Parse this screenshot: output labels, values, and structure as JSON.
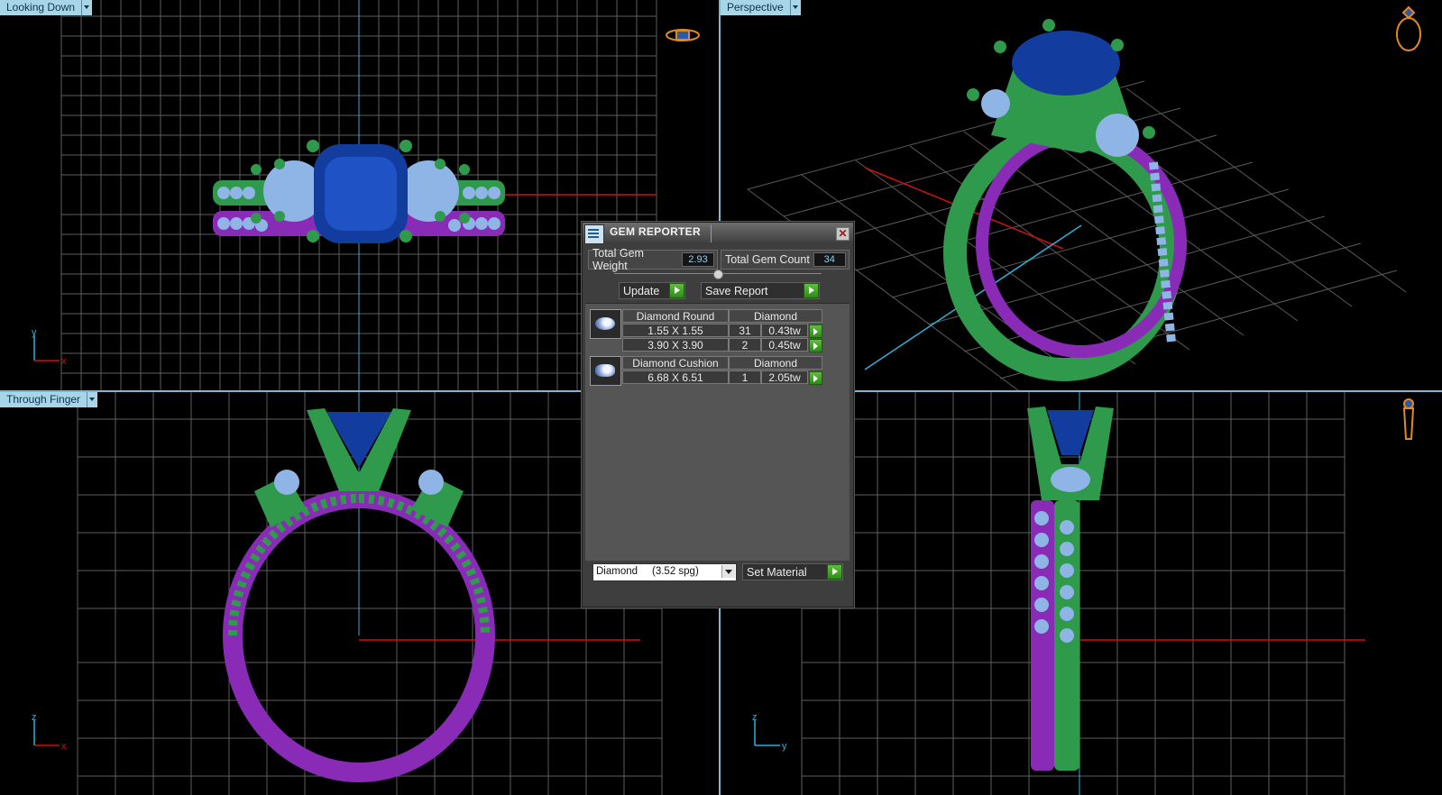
{
  "viewports": {
    "top_left": {
      "label": "Looking Down",
      "axis": {
        "vertical": "y",
        "horizontal": "x"
      }
    },
    "top_right": {
      "label": "Perspective"
    },
    "bottom_left": {
      "label": "Through Finger",
      "axis": {
        "vertical": "z",
        "horizontal": "x"
      }
    },
    "bottom_right": {
      "label": "",
      "axis": {
        "vertical": "z",
        "horizontal": "y"
      }
    }
  },
  "dialog": {
    "title": "GEM REPORTER",
    "close_glyph": "✕",
    "total_weight_label": "Total Gem Weight",
    "total_weight_value": "2.93",
    "total_count_label": "Total Gem Count",
    "total_count_value": "34",
    "update_label": "Update",
    "save_report_label": "Save Report",
    "groups": [
      {
        "name": "Diamond Round",
        "material": "Diamond",
        "rows": [
          {
            "size": "1.55 X 1.55",
            "count": "31",
            "weight": "0.43tw"
          },
          {
            "size": "3.90 X 3.90",
            "count": "2",
            "weight": "0.45tw"
          }
        ]
      },
      {
        "name": "Diamond Cushion",
        "material": "Diamond",
        "rows": [
          {
            "size": "6.68 X 6.51",
            "count": "1",
            "weight": "2.05tw"
          }
        ]
      }
    ],
    "material_select_value": "Diamond     (3.52 spg)",
    "set_material_label": "Set Material"
  },
  "colors": {
    "metal_green": "#2f9a4c",
    "metal_purple": "#8a2bb8",
    "center_stone": "#123c9e",
    "side_stone": "#8fb4e6",
    "grid": "#6a6a6a",
    "axis_red": "#d01010",
    "axis_cyan": "#2fb0d8",
    "viewport_label_bg": "#a9d5e8"
  }
}
